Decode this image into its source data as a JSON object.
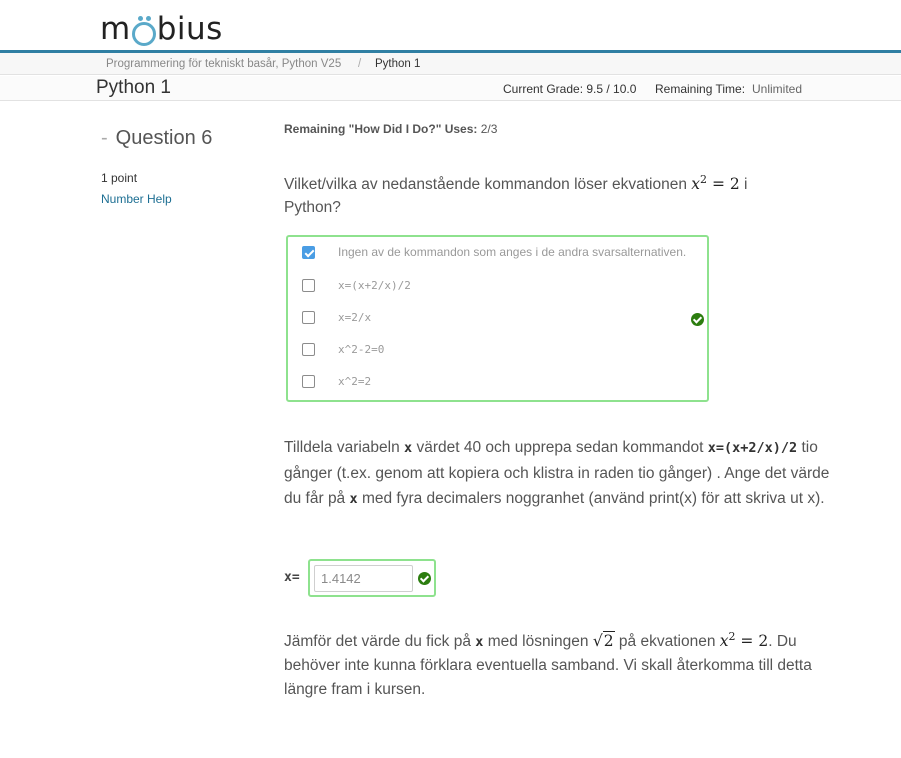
{
  "header": {
    "logo_text_left": "m",
    "logo_text_right": "bius"
  },
  "breadcrumb": {
    "parent": "Programmering för tekniskt basår, Python V25",
    "separator": "/",
    "current": "Python 1"
  },
  "titlebar": {
    "title": "Python 1",
    "current_grade": "Current Grade: 9.5 / 10.0",
    "remaining_time_label": "Remaining Time:",
    "remaining_time_value": "Unlimited"
  },
  "question": {
    "dash": "-",
    "heading": "Question 6",
    "points": "1 point",
    "number_help": "Number Help",
    "how_did_i_do_label": "Remaining \"How Did I Do?\" Uses:",
    "how_did_i_do_value": "2/3"
  },
  "part1": {
    "text_before": "Vilket/vilka av nedanstående kommandon löser ekvationen ",
    "eq_var": "x",
    "eq_exp": "2",
    "eq_rest": " = 2",
    "text_after": " i Python?",
    "choices": [
      {
        "label": "Ingen av de kommandon som anges i de andra svarsalternativen.",
        "checked": true
      },
      {
        "label": "x=(x+2/x)/2",
        "checked": false
      },
      {
        "label": "x=2/x",
        "checked": false
      },
      {
        "label": "x^2-2=0",
        "checked": false
      },
      {
        "label": "x^2=2",
        "checked": false
      }
    ],
    "status_icon": "check-circle-icon",
    "status_color": "#2c7d0f"
  },
  "part2": {
    "t1": "Tilldela variabeln ",
    "var": "x",
    "t2": " värdet 40 och upprepa sedan kommandot ",
    "command": "x=(x+2/x)/2",
    "t3": " tio gånger (t.ex. genom att kopiera och klistra in raden tio gånger) . Ange det värde du får på ",
    "var2": "x",
    "t4": " med fyra decimalers noggranhet (använd print(x) för att skriva ut x).",
    "input_label": "x=",
    "input_value": "1.4142",
    "status_icon": "check-circle-icon"
  },
  "part3": {
    "t1": "Jämför det värde du fick på ",
    "var": "x",
    "t2": " med lösningen ",
    "sqrt_symbol": "√",
    "sqrt_arg": "2",
    "t3": " på ekvationen ",
    "eq_var": "x",
    "eq_exp": "2",
    "eq_rest": " = 2",
    "t4": ". Du behöver inte kunna förklara eventuella samband. Vi skall återkomma till detta längre fram i kursen."
  },
  "colors": {
    "accent_line": "#2f7fa3",
    "correct_border": "#8ee28e",
    "checkbox_checked": "#4a9de4",
    "link": "#1d6f93"
  }
}
